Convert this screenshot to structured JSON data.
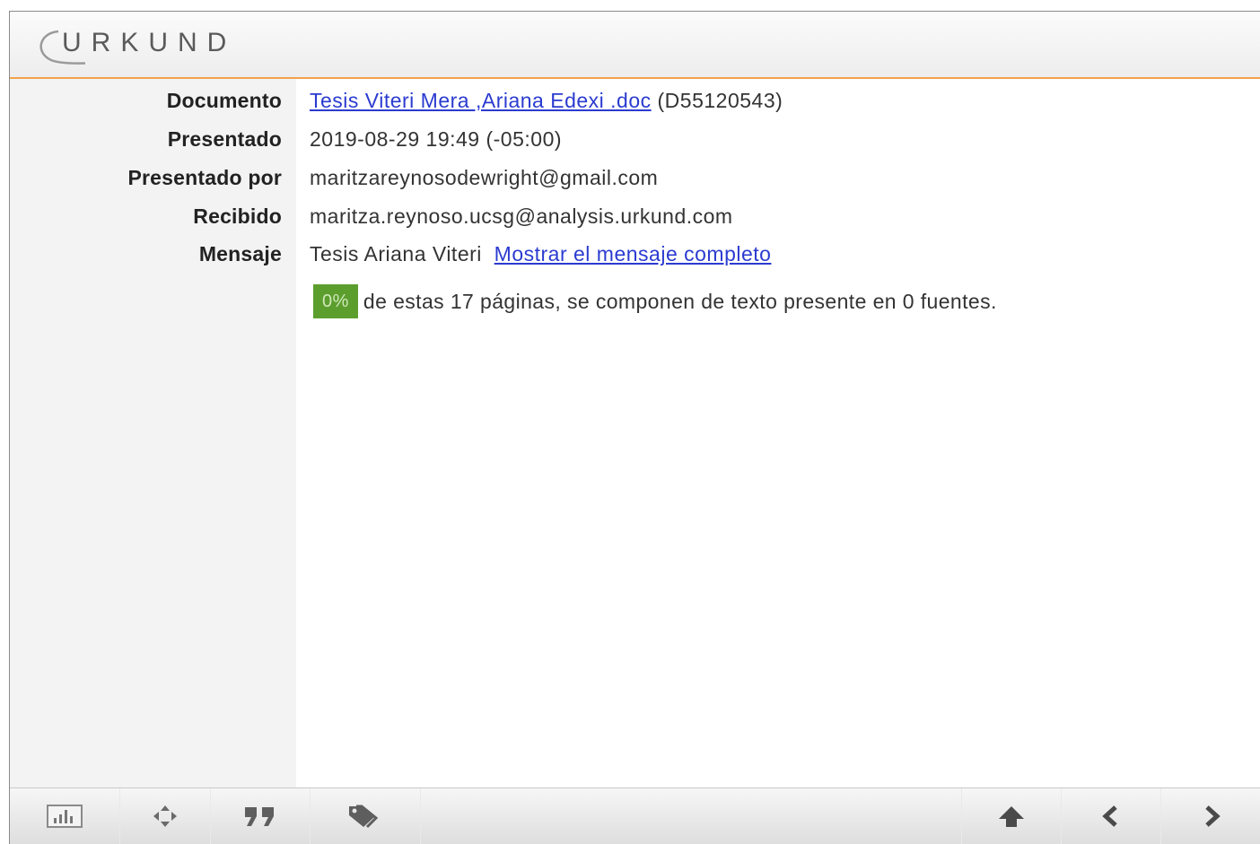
{
  "app": {
    "logo_text": "URKUND"
  },
  "details": {
    "documento": {
      "label": "Documento",
      "file_name": "Tesis Viteri Mera ,Ariana Edexi .doc",
      "doc_id": "(D55120543)"
    },
    "presentado": {
      "label": "Presentado",
      "value": "2019-08-29 19:49 (-05:00)"
    },
    "presentado_por": {
      "label": "Presentado por",
      "value": "maritzareynosodewright@gmail.com"
    },
    "recibido": {
      "label": "Recibido",
      "value": "maritza.reynoso.ucsg@analysis.urkund.com"
    },
    "mensaje": {
      "label": "Mensaje",
      "value": "Tesis Ariana Viteri",
      "link": "Mostrar el mensaje completo"
    }
  },
  "summary": {
    "badge": "0%",
    "text": "de estas 17 páginas, se componen de texto presente en 0 fuentes."
  },
  "toolbar": {
    "buttons": [
      "bar-chart-icon",
      "move-arrows-icon",
      "quote-icon",
      "tags-icon",
      "arrow-up-icon",
      "chevron-left-icon",
      "chevron-right-icon"
    ]
  },
  "colors": {
    "accent": "#f0a24a",
    "link": "#2b3bd0",
    "badge": "#5c9e2e"
  }
}
